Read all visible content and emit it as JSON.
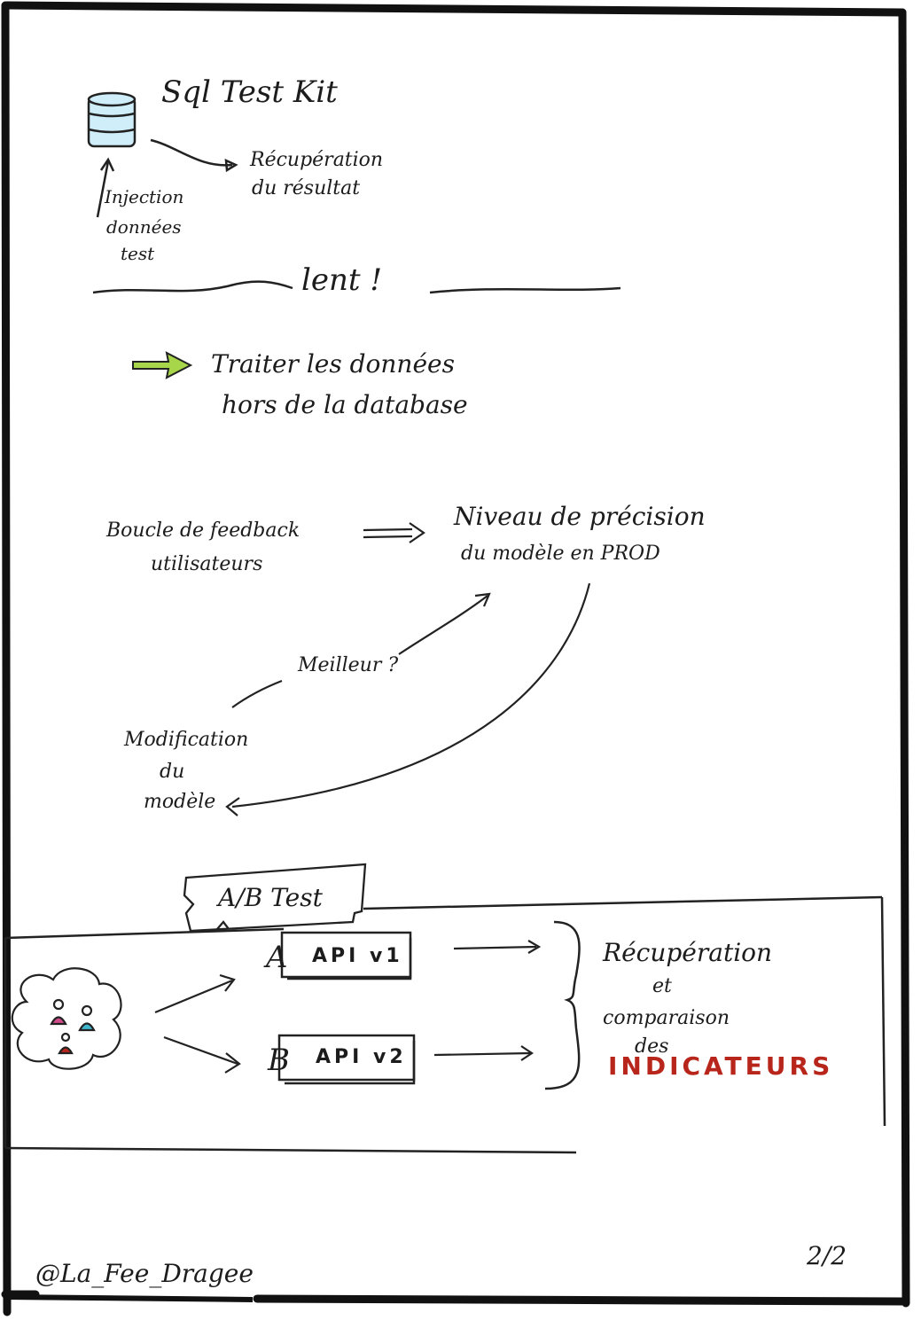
{
  "colors": {
    "ink": "#1c1c1c",
    "database_fill": "#cfeefa",
    "green_arrow": "#a8d64a",
    "red_accent": "#b8261b",
    "pink": "#d14a8a",
    "cyan": "#3fb7cf"
  },
  "sql_section": {
    "title": "Sql Test Kit",
    "icon": "database-icon",
    "injection_label": [
      "Injection",
      "données",
      "test"
    ],
    "result_label": [
      "Récupération",
      "du résultat"
    ],
    "separator_word": "lent !"
  },
  "advice": {
    "icon": "green-arrow-icon",
    "lines": [
      "Traiter les données",
      "hors de la database"
    ]
  },
  "feedback_cycle": {
    "source": [
      "Boucle de feedback",
      "utilisateurs"
    ],
    "target": [
      "Niveau de précision",
      "du modèle en PROD"
    ],
    "question": "Meilleur ?",
    "modification": [
      "Modification",
      "du",
      "modèle"
    ]
  },
  "ab_test": {
    "banner": "A/B Test",
    "variant_a_letter": "A",
    "variant_a_label": "API v1",
    "variant_b_letter": "B",
    "variant_b_label": "API v2",
    "users_icon": "users-cloud-icon",
    "outcome": [
      "Récupération",
      "et",
      "comparaison",
      "des"
    ],
    "outcome_highlight": "INDICATEURS"
  },
  "footer": {
    "author": "@La_Fee_Dragee",
    "page": "2/2"
  }
}
